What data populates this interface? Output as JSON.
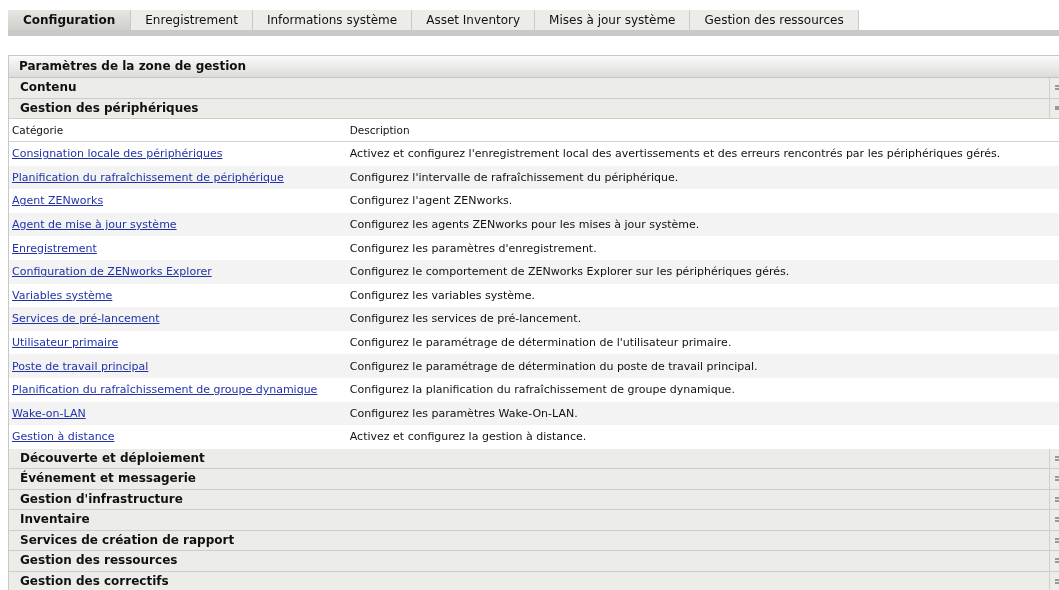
{
  "tabs": [
    {
      "label": "Configuration",
      "selected": true
    },
    {
      "label": "Enregistrement",
      "selected": false
    },
    {
      "label": "Informations système",
      "selected": false
    },
    {
      "label": "Asset Inventory",
      "selected": false
    },
    {
      "label": "Mises à jour système",
      "selected": false
    },
    {
      "label": "Gestion des ressources",
      "selected": false
    }
  ],
  "panel": {
    "title": "Paramètres de la zone de gestion",
    "sections": [
      {
        "title": "Contenu",
        "expanded": false
      },
      {
        "title": "Gestion des périphériques",
        "expanded": true,
        "table": {
          "columns": [
            "Catégorie",
            "Description"
          ],
          "rows": [
            {
              "category": "Consignation locale des périphériques",
              "description": "Activez et configurez l'enregistrement local des avertissements et des erreurs rencontrés par les périphériques gérés."
            },
            {
              "category": "Planification du rafraîchissement de périphérique",
              "description": "Configurez l'intervalle de rafraîchissement du périphérique."
            },
            {
              "category": "Agent ZENworks",
              "description": "Configurez l'agent ZENworks."
            },
            {
              "category": "Agent de mise à jour système",
              "description": "Configurez les agents ZENworks pour les mises à jour système."
            },
            {
              "category": "Enregistrement",
              "description": "Configurez les paramètres d'enregistrement."
            },
            {
              "category": "Configuration de ZENworks Explorer",
              "description": "Configurez le comportement de ZENworks Explorer sur les périphériques gérés."
            },
            {
              "category": "Variables système",
              "description": "Configurez les variables système."
            },
            {
              "category": "Services de pré-lancement",
              "description": "Configurez les services de pré-lancement."
            },
            {
              "category": "Utilisateur primaire",
              "description": "Configurez le paramétrage de détermination de l'utilisateur primaire."
            },
            {
              "category": "Poste de travail principal",
              "description": "Configurez le paramétrage de détermination du poste de travail principal."
            },
            {
              "category": "Planification du rafraîchissement de groupe dynamique",
              "description": "Configurez la planification du rafraîchissement de groupe dynamique."
            },
            {
              "category": "Wake-on-LAN",
              "description": "Configurez les paramètres Wake-On-LAN."
            },
            {
              "category": "Gestion à distance",
              "description": "Activez et configurez la gestion à distance."
            }
          ]
        }
      },
      {
        "title": "Découverte et déploiement",
        "expanded": false
      },
      {
        "title": "Événement et messagerie",
        "expanded": false
      },
      {
        "title": "Gestion d'infrastructure",
        "expanded": false
      },
      {
        "title": "Inventaire",
        "expanded": false
      },
      {
        "title": "Services de création de rapport",
        "expanded": false
      },
      {
        "title": "Gestion des ressources",
        "expanded": false
      },
      {
        "title": "Gestion des correctifs",
        "expanded": false
      }
    ]
  }
}
